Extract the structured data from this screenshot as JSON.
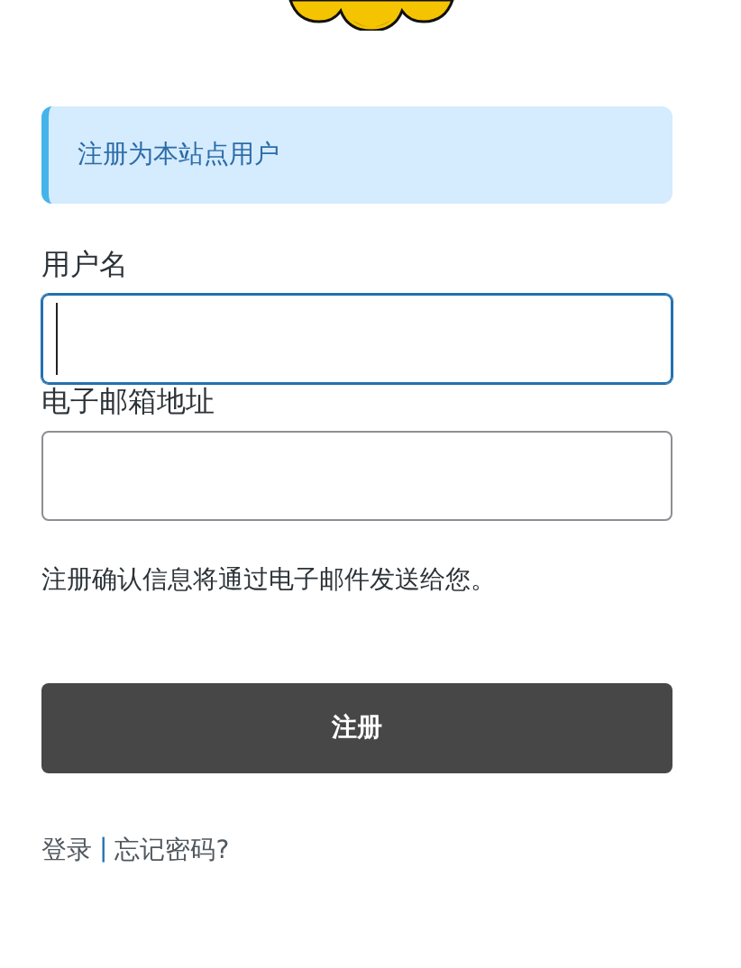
{
  "notice": "注册为本站点用户",
  "fields": [
    {
      "label": "用户名",
      "focused": true
    },
    {
      "label": "电子邮箱地址",
      "focused": false
    }
  ],
  "message": "注册确认信息将通过电子邮件发送给您。",
  "submit": "注册",
  "links": [
    {
      "kind": "link",
      "text": "登录"
    },
    {
      "kind": "separator",
      "text": "|"
    },
    {
      "kind": "link",
      "text": "忘记密码?"
    }
  ]
}
